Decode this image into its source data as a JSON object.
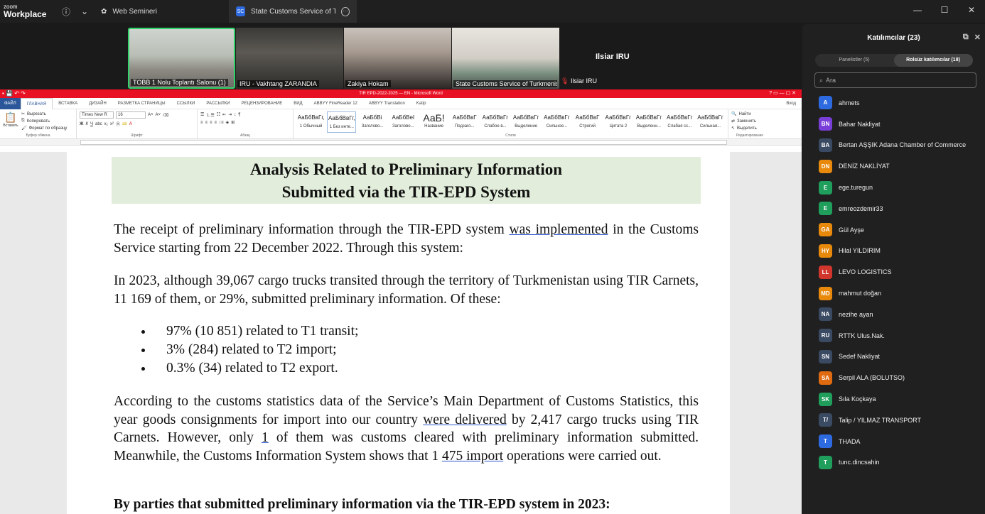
{
  "app": {
    "logo_line1": "zoom",
    "logo_line2": "Workplace",
    "info_icon": "info-icon",
    "chevron_icon": "chevron-down-icon"
  },
  "tabs": [
    {
      "label": "Web Semineri",
      "icon": "paw-icon"
    },
    {
      "label": "State Customs Service of Turkmenistan",
      "badge": "SC",
      "more_icon": "more-icon"
    }
  ],
  "window_controls": [
    "—",
    "☐",
    "✕"
  ],
  "videos": [
    {
      "name": "TOBB 1 Nolu Toplantı Salonu (1)",
      "speaking": true
    },
    {
      "name": "IRU - Vakhtang ZARANDIA",
      "speaking": false
    },
    {
      "name": "Zakiya Hokam",
      "speaking": false
    },
    {
      "name": "State Customs Service of Turkmenistan",
      "speaking": false
    }
  ],
  "ilsiar": {
    "tile_name": "Ilsiar IRU",
    "label": "Ilsiar IRU",
    "mic_icon": "mic-muted-icon"
  },
  "word": {
    "title": "TIR EPD-2022-2025 — EN - Microsoft Word",
    "login": "Вход",
    "menu": [
      "ФАЙЛ",
      "ГЛАВНАЯ",
      "ВСТАВКА",
      "ДИЗАЙН",
      "РАЗМЕТКА СТРАНИЦЫ",
      "ССЫЛКИ",
      "РАССЫЛКИ",
      "РЕЦЕНЗИРОВАНИЕ",
      "ВИД",
      "ABBYY FineReader 12",
      "ABBYY Translation",
      "Katip"
    ],
    "clipboard": {
      "paste": "Вставить",
      "cut": "Вырезать",
      "copy": "Копировать",
      "format": "Формат по образцу",
      "label": "Буфер обмена"
    },
    "font": {
      "name": "Times New R",
      "size": "16",
      "label": "Шрифт"
    },
    "paragraph_label": "Абзац",
    "styles": [
      {
        "sample": "АаБбВвГг,",
        "name": "1 Обычный"
      },
      {
        "sample": "АаБбВвГг,",
        "name": "1 Без инте..."
      },
      {
        "sample": "АаБбВі",
        "name": "Заголово..."
      },
      {
        "sample": "АаБбВеІ",
        "name": "Заголово..."
      },
      {
        "sample": "АаБ!",
        "name": "Название"
      },
      {
        "sample": "АаБбВвГ",
        "name": "Подзаго..."
      },
      {
        "sample": "АаБбВвГг",
        "name": "Слабое в..."
      },
      {
        "sample": "АаБбВвГг",
        "name": "Выделение"
      },
      {
        "sample": "АаБбВвГг",
        "name": "Сильное..."
      },
      {
        "sample": "АаБбВвГ",
        "name": "Строгий"
      },
      {
        "sample": "АаБбВвГг",
        "name": "Цитата 2"
      },
      {
        "sample": "АаБбВвГг",
        "name": "Выделенн..."
      },
      {
        "sample": "АаБбВвГг",
        "name": "Слабая сс..."
      },
      {
        "sample": "АаБбВвГг",
        "name": "Сильная..."
      }
    ],
    "styles_label": "Стили",
    "editing": {
      "find": "Найти",
      "replace": "Заменить",
      "select": "Выделить",
      "label": "Редактирование"
    },
    "doc": {
      "heading_line1": "Analysis Related to Preliminary Information",
      "heading_line2": "Submitted via the TIR-EPD System",
      "p1_a": "The receipt of preliminary information through the TIR-EPD system ",
      "p1_u": "was implemented",
      "p1_b": " in the Customs Service starting from 22 December 2022. Through this system:",
      "p2": "In 2023, although 39,067 cargo trucks transited through the territory of Turkmenistan using TIR Carnets, 11 169 of them, or 29%, submitted preliminary information. Of these:",
      "bullets": [
        "97% (10 851) related to T1 transit;",
        "3% (284) related to T2 import;",
        "0.3% (34) related to T2 export."
      ],
      "p3_a": "According to the customs statistics data of the Service’s Main Department of Customs Statistics, this year goods consignments for import into our country ",
      "p3_u1": "were delivered",
      "p3_b": " by 2,417 cargo trucks using TIR Carnets. However, only ",
      "p3_u2": "1",
      "p3_c": " of them was customs cleared with preliminary information submitted. Meanwhile, the Customs Information System shows that 1 ",
      "p3_u3": "475 import",
      "p3_d": " operations were carried out.",
      "p4": "By parties that submitted preliminary information via the TIR-EPD system in 2023:"
    }
  },
  "participants": {
    "title": "Katılımcılar (23)",
    "tab_panelists": "Panelistler (5)",
    "tab_attendees": "Rolsüz katılımcılar (18)",
    "search_placeholder": "Ara",
    "list": [
      {
        "initials": "A",
        "name": "ahmets",
        "color": "#2d6ae0"
      },
      {
        "initials": "BN",
        "name": "Bahar Nakliyat",
        "color": "#7a3ed8"
      },
      {
        "initials": "BA",
        "name": "Bertan AŞŞIK Adana Chamber of Commerce",
        "color": "#3a4a63"
      },
      {
        "initials": "DN",
        "name": "DENİZ NAKLİYAT",
        "color": "#e8890c"
      },
      {
        "initials": "E",
        "name": "ege.turegun",
        "color": "#1f9e5c"
      },
      {
        "initials": "E",
        "name": "emreozdemir33",
        "color": "#1f9e5c"
      },
      {
        "initials": "GA",
        "name": "Gül Ayşe",
        "color": "#e8890c"
      },
      {
        "initials": "HY",
        "name": "Hilal YILDIRIM",
        "color": "#e8890c"
      },
      {
        "initials": "LL",
        "name": "LEVO LOGISTICS",
        "color": "#d0362c"
      },
      {
        "initials": "MD",
        "name": "mahmut doğan",
        "color": "#e8890c"
      },
      {
        "initials": "NA",
        "name": "nezihe ayan",
        "color": "#3a4a63"
      },
      {
        "initials": "RU",
        "name": "RTTK Ulus.Nak.",
        "color": "#3a4a63"
      },
      {
        "initials": "SN",
        "name": "Sedef  Nakliyat",
        "color": "#3a4a63"
      },
      {
        "initials": "SA",
        "name": "Serpil ALA (BOLUTSO)",
        "color": "#e06a10"
      },
      {
        "initials": "SK",
        "name": "Sıla Koçkaya",
        "color": "#1f9e5c"
      },
      {
        "initials": "T/",
        "name": "Talip / YILMAZ TRANSPORT",
        "color": "#3a4a63"
      },
      {
        "initials": "T",
        "name": "THADA",
        "color": "#2d6ae0"
      },
      {
        "initials": "T",
        "name": "tunc.dincsahin",
        "color": "#1f9e5c"
      }
    ]
  }
}
